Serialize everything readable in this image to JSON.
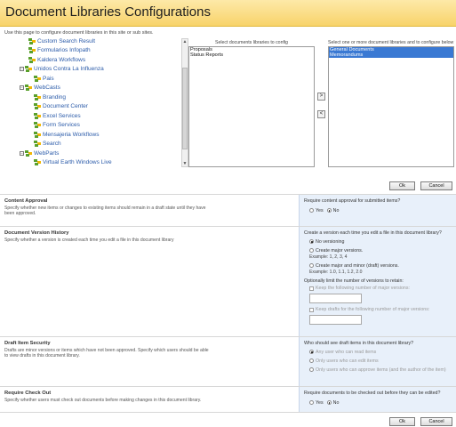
{
  "title": "Document Libraries Configurations",
  "intro": "Use this page to configure document libraries in this site or sub sites.",
  "tree": [
    {
      "label": "Custom Search Result",
      "expander": ""
    },
    {
      "label": "Formularios Infopath",
      "expander": ""
    },
    {
      "label": "Kaldera Workflows",
      "expander": ""
    },
    {
      "label": "Unidos Contra La Influenza",
      "expander": "−"
    },
    {
      "label": "Pais",
      "expander": ""
    },
    {
      "label": "WebCasts",
      "expander": "−"
    },
    {
      "label": "Branding",
      "expander": ""
    },
    {
      "label": "Document Center",
      "expander": ""
    },
    {
      "label": "Excel Services",
      "expander": ""
    },
    {
      "label": "Form Services",
      "expander": ""
    },
    {
      "label": "Mensajeria Workflows",
      "expander": ""
    },
    {
      "label": "Search",
      "expander": ""
    },
    {
      "label": "WebParts",
      "expander": "−"
    },
    {
      "label": "Virtual Earth Windows Live",
      "expander": ""
    }
  ],
  "source_list": {
    "title": "Select documents libraries to config",
    "items": [
      "Proposals",
      "Status Reports"
    ]
  },
  "target_list": {
    "title": "Select one or more document libraries and to configure below",
    "items": [
      "General Documents",
      "Memorandums"
    ],
    "selected": [
      0,
      1
    ]
  },
  "move_right": ">",
  "move_left": "<",
  "top_buttons": {
    "ok": "Ok",
    "cancel": "Cancel"
  },
  "content_approval": {
    "title": "Content Approval",
    "desc": "Specify whether new items or changes to existing items should remain in a draft state until they have been approved.",
    "question": "Require content approval for submitted items?",
    "yes": "Yes",
    "no": "No",
    "selected": "no"
  },
  "version_history": {
    "title": "Document Version History",
    "desc": "Specify whether a version is created each time you edit a file in this document library",
    "question": "Create a version each time you edit a file in this document library?",
    "opt_none": "No versioning",
    "opt_major": "Create major versions.",
    "example_major": "Example: 1, 2, 3, 4",
    "opt_minor": "Create major and minor (draft) versions.",
    "example_minor": "Example: 1.0, 1.1, 1.2, 2.0",
    "limit_label": "Optionally limit the number of versions to retain:",
    "keep_major": "Keep the following number of major versions:",
    "keep_drafts": "Keep drafts for the following number of major versions:",
    "major_value": "",
    "drafts_value": "",
    "selected": "none"
  },
  "draft_security": {
    "title": "Draft Item Security",
    "desc": "Drafts are minor versions or items which have not been approved. Specify which users should be able to view drafts in this document library.",
    "question": "Who should see draft items in this document library?",
    "opt_any": "Any user who can read items",
    "opt_edit": "Only users who can edit items",
    "opt_approve": "Only users who can approve items (and the author of the item)",
    "selected": "any"
  },
  "check_out": {
    "title": "Require Check Out",
    "desc": "Specify whether users must check out documents before making changes in this document library.",
    "question": "Require documents to be checked out before they can be edited?",
    "yes": "Yes",
    "no": "No",
    "selected": "no"
  },
  "bottom_buttons": {
    "ok": "Ok",
    "cancel": "Cancel"
  },
  "colors": {
    "site_icon": "#5aa02c",
    "site_icon_2": "#f2b705",
    "link": "#2b5ba9",
    "selection": "#3a79d3",
    "right_panel": "#e8f0fa"
  }
}
